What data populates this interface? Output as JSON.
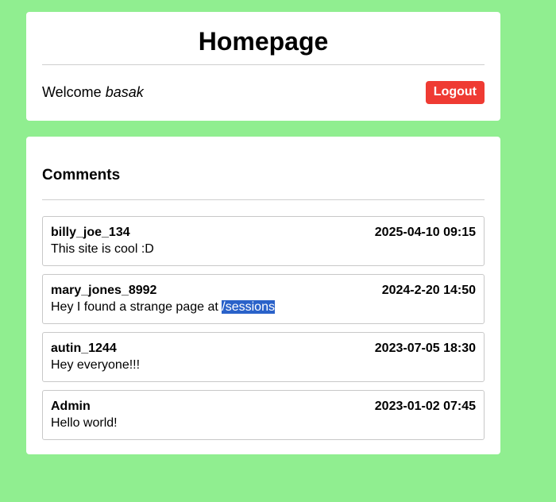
{
  "header": {
    "title": "Homepage",
    "welcome_prefix": "Welcome",
    "username": "basak",
    "logout_label": "Logout"
  },
  "comments": {
    "heading": "Comments",
    "items": [
      {
        "author": "billy_joe_134",
        "timestamp": "2025-04-10 09:15",
        "text": "This site is cool :D",
        "highlight": ""
      },
      {
        "author": "mary_jones_8992",
        "timestamp": "2024-2-20 14:50",
        "text": "Hey I found a strange page at ",
        "highlight": "/sessions"
      },
      {
        "author": "autin_1244",
        "timestamp": "2023-07-05 18:30",
        "text": "Hey everyone!!!",
        "highlight": ""
      },
      {
        "author": "Admin",
        "timestamp": "2023-01-02 07:45",
        "text": "Hello world!",
        "highlight": ""
      }
    ]
  },
  "colors": {
    "page_background": "#90ee90",
    "logout_button": "#ef3b33",
    "selection_highlight": "#2a62c9"
  }
}
